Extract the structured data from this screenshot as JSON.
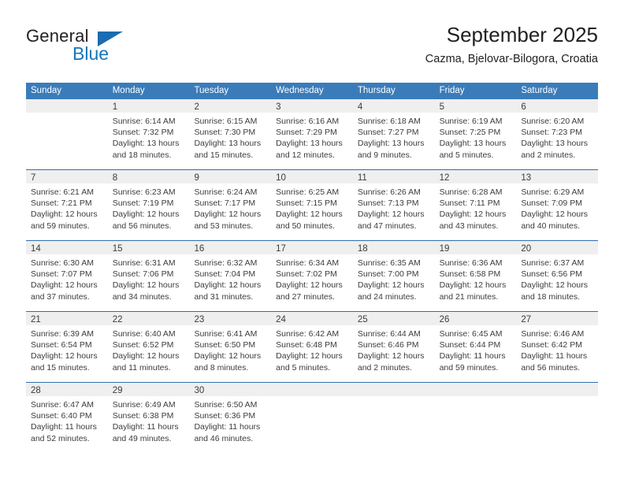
{
  "brand": {
    "name_top": "General",
    "name_bottom": "Blue",
    "color_blue": "#1676bc",
    "color_triangle": "#1b6cb0"
  },
  "header": {
    "title": "September 2025",
    "subtitle": "Cazma, Bjelovar-Bilogora, Croatia"
  },
  "theme": {
    "header_row_bg": "#3a7cba",
    "day_band_bg": "#efefef",
    "week_divider": "#2f6fab",
    "text": "#3c3c3c"
  },
  "weekdays": [
    "Sunday",
    "Monday",
    "Tuesday",
    "Wednesday",
    "Thursday",
    "Friday",
    "Saturday"
  ],
  "weeks": [
    [
      {
        "day": "",
        "l1": "",
        "l2": "",
        "l3": "",
        "l4": "",
        "empty": true
      },
      {
        "day": "1",
        "l1": "Sunrise: 6:14 AM",
        "l2": "Sunset: 7:32 PM",
        "l3": "Daylight: 13 hours",
        "l4": "and 18 minutes."
      },
      {
        "day": "2",
        "l1": "Sunrise: 6:15 AM",
        "l2": "Sunset: 7:30 PM",
        "l3": "Daylight: 13 hours",
        "l4": "and 15 minutes."
      },
      {
        "day": "3",
        "l1": "Sunrise: 6:16 AM",
        "l2": "Sunset: 7:29 PM",
        "l3": "Daylight: 13 hours",
        "l4": "and 12 minutes."
      },
      {
        "day": "4",
        "l1": "Sunrise: 6:18 AM",
        "l2": "Sunset: 7:27 PM",
        "l3": "Daylight: 13 hours",
        "l4": "and 9 minutes."
      },
      {
        "day": "5",
        "l1": "Sunrise: 6:19 AM",
        "l2": "Sunset: 7:25 PM",
        "l3": "Daylight: 13 hours",
        "l4": "and 5 minutes."
      },
      {
        "day": "6",
        "l1": "Sunrise: 6:20 AM",
        "l2": "Sunset: 7:23 PM",
        "l3": "Daylight: 13 hours",
        "l4": "and 2 minutes."
      }
    ],
    [
      {
        "day": "7",
        "l1": "Sunrise: 6:21 AM",
        "l2": "Sunset: 7:21 PM",
        "l3": "Daylight: 12 hours",
        "l4": "and 59 minutes."
      },
      {
        "day": "8",
        "l1": "Sunrise: 6:23 AM",
        "l2": "Sunset: 7:19 PM",
        "l3": "Daylight: 12 hours",
        "l4": "and 56 minutes."
      },
      {
        "day": "9",
        "l1": "Sunrise: 6:24 AM",
        "l2": "Sunset: 7:17 PM",
        "l3": "Daylight: 12 hours",
        "l4": "and 53 minutes."
      },
      {
        "day": "10",
        "l1": "Sunrise: 6:25 AM",
        "l2": "Sunset: 7:15 PM",
        "l3": "Daylight: 12 hours",
        "l4": "and 50 minutes."
      },
      {
        "day": "11",
        "l1": "Sunrise: 6:26 AM",
        "l2": "Sunset: 7:13 PM",
        "l3": "Daylight: 12 hours",
        "l4": "and 47 minutes."
      },
      {
        "day": "12",
        "l1": "Sunrise: 6:28 AM",
        "l2": "Sunset: 7:11 PM",
        "l3": "Daylight: 12 hours",
        "l4": "and 43 minutes."
      },
      {
        "day": "13",
        "l1": "Sunrise: 6:29 AM",
        "l2": "Sunset: 7:09 PM",
        "l3": "Daylight: 12 hours",
        "l4": "and 40 minutes."
      }
    ],
    [
      {
        "day": "14",
        "l1": "Sunrise: 6:30 AM",
        "l2": "Sunset: 7:07 PM",
        "l3": "Daylight: 12 hours",
        "l4": "and 37 minutes."
      },
      {
        "day": "15",
        "l1": "Sunrise: 6:31 AM",
        "l2": "Sunset: 7:06 PM",
        "l3": "Daylight: 12 hours",
        "l4": "and 34 minutes."
      },
      {
        "day": "16",
        "l1": "Sunrise: 6:32 AM",
        "l2": "Sunset: 7:04 PM",
        "l3": "Daylight: 12 hours",
        "l4": "and 31 minutes."
      },
      {
        "day": "17",
        "l1": "Sunrise: 6:34 AM",
        "l2": "Sunset: 7:02 PM",
        "l3": "Daylight: 12 hours",
        "l4": "and 27 minutes."
      },
      {
        "day": "18",
        "l1": "Sunrise: 6:35 AM",
        "l2": "Sunset: 7:00 PM",
        "l3": "Daylight: 12 hours",
        "l4": "and 24 minutes."
      },
      {
        "day": "19",
        "l1": "Sunrise: 6:36 AM",
        "l2": "Sunset: 6:58 PM",
        "l3": "Daylight: 12 hours",
        "l4": "and 21 minutes."
      },
      {
        "day": "20",
        "l1": "Sunrise: 6:37 AM",
        "l2": "Sunset: 6:56 PM",
        "l3": "Daylight: 12 hours",
        "l4": "and 18 minutes."
      }
    ],
    [
      {
        "day": "21",
        "l1": "Sunrise: 6:39 AM",
        "l2": "Sunset: 6:54 PM",
        "l3": "Daylight: 12 hours",
        "l4": "and 15 minutes."
      },
      {
        "day": "22",
        "l1": "Sunrise: 6:40 AM",
        "l2": "Sunset: 6:52 PM",
        "l3": "Daylight: 12 hours",
        "l4": "and 11 minutes."
      },
      {
        "day": "23",
        "l1": "Sunrise: 6:41 AM",
        "l2": "Sunset: 6:50 PM",
        "l3": "Daylight: 12 hours",
        "l4": "and 8 minutes."
      },
      {
        "day": "24",
        "l1": "Sunrise: 6:42 AM",
        "l2": "Sunset: 6:48 PM",
        "l3": "Daylight: 12 hours",
        "l4": "and 5 minutes."
      },
      {
        "day": "25",
        "l1": "Sunrise: 6:44 AM",
        "l2": "Sunset: 6:46 PM",
        "l3": "Daylight: 12 hours",
        "l4": "and 2 minutes."
      },
      {
        "day": "26",
        "l1": "Sunrise: 6:45 AM",
        "l2": "Sunset: 6:44 PM",
        "l3": "Daylight: 11 hours",
        "l4": "and 59 minutes."
      },
      {
        "day": "27",
        "l1": "Sunrise: 6:46 AM",
        "l2": "Sunset: 6:42 PM",
        "l3": "Daylight: 11 hours",
        "l4": "and 56 minutes."
      }
    ],
    [
      {
        "day": "28",
        "l1": "Sunrise: 6:47 AM",
        "l2": "Sunset: 6:40 PM",
        "l3": "Daylight: 11 hours",
        "l4": "and 52 minutes."
      },
      {
        "day": "29",
        "l1": "Sunrise: 6:49 AM",
        "l2": "Sunset: 6:38 PM",
        "l3": "Daylight: 11 hours",
        "l4": "and 49 minutes."
      },
      {
        "day": "30",
        "l1": "Sunrise: 6:50 AM",
        "l2": "Sunset: 6:36 PM",
        "l3": "Daylight: 11 hours",
        "l4": "and 46 minutes."
      },
      {
        "day": "",
        "l1": "",
        "l2": "",
        "l3": "",
        "l4": "",
        "empty": true
      },
      {
        "day": "",
        "l1": "",
        "l2": "",
        "l3": "",
        "l4": "",
        "empty": true
      },
      {
        "day": "",
        "l1": "",
        "l2": "",
        "l3": "",
        "l4": "",
        "empty": true
      },
      {
        "day": "",
        "l1": "",
        "l2": "",
        "l3": "",
        "l4": "",
        "empty": true
      }
    ]
  ]
}
